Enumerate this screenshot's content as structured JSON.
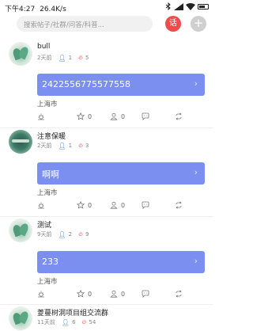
{
  "status_bar": {
    "time": "下午4:27",
    "speed": "26.4K/s"
  },
  "header": {
    "search_placeholder": "搜索帖子/社群/问答/科普...",
    "post_button_label": "话",
    "add_button_label": "+"
  },
  "posts": [
    {
      "name": "bull",
      "time": "2天前",
      "people_count": "1",
      "hot_count": "5",
      "content": "2422556775577558",
      "location": "上海市",
      "likes": "0",
      "follows": "0"
    },
    {
      "name": "注意保暖",
      "time": "2天前",
      "people_count": "1",
      "hot_count": "3",
      "content": "啊啊",
      "location": "上海市",
      "likes": "0",
      "follows": "0"
    },
    {
      "name": "测试",
      "time": "9天前",
      "people_count": "2",
      "hot_count": "9",
      "content": "233",
      "location": "上海市",
      "likes": "0",
      "follows": "0"
    },
    {
      "name": "菱蔓树洞项目组交流群",
      "time": "11天前",
      "people_count": "6",
      "hot_count": "54"
    }
  ],
  "colors": {
    "card": "#7a8ff0",
    "accent_red": "#ef4b4b",
    "person_blue": "#3b7de0"
  }
}
